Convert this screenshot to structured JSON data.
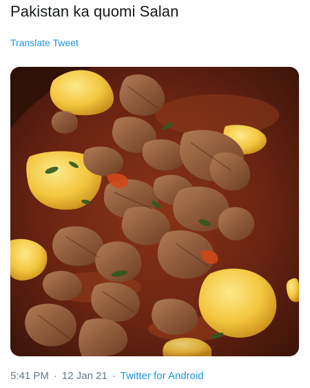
{
  "tweet": {
    "text": "Pakistan ka quomi Salan",
    "translate_label": "Translate Tweet",
    "time": "5:41 PM",
    "separator": "·",
    "date": "12 Jan 21",
    "source": "Twitter for Android"
  },
  "colors": {
    "text": "#14171a",
    "link": "#1b95e0",
    "meta": "#657786",
    "gravy": "#6b2412",
    "potato": "#f0c640",
    "meat": "#8a5434"
  }
}
